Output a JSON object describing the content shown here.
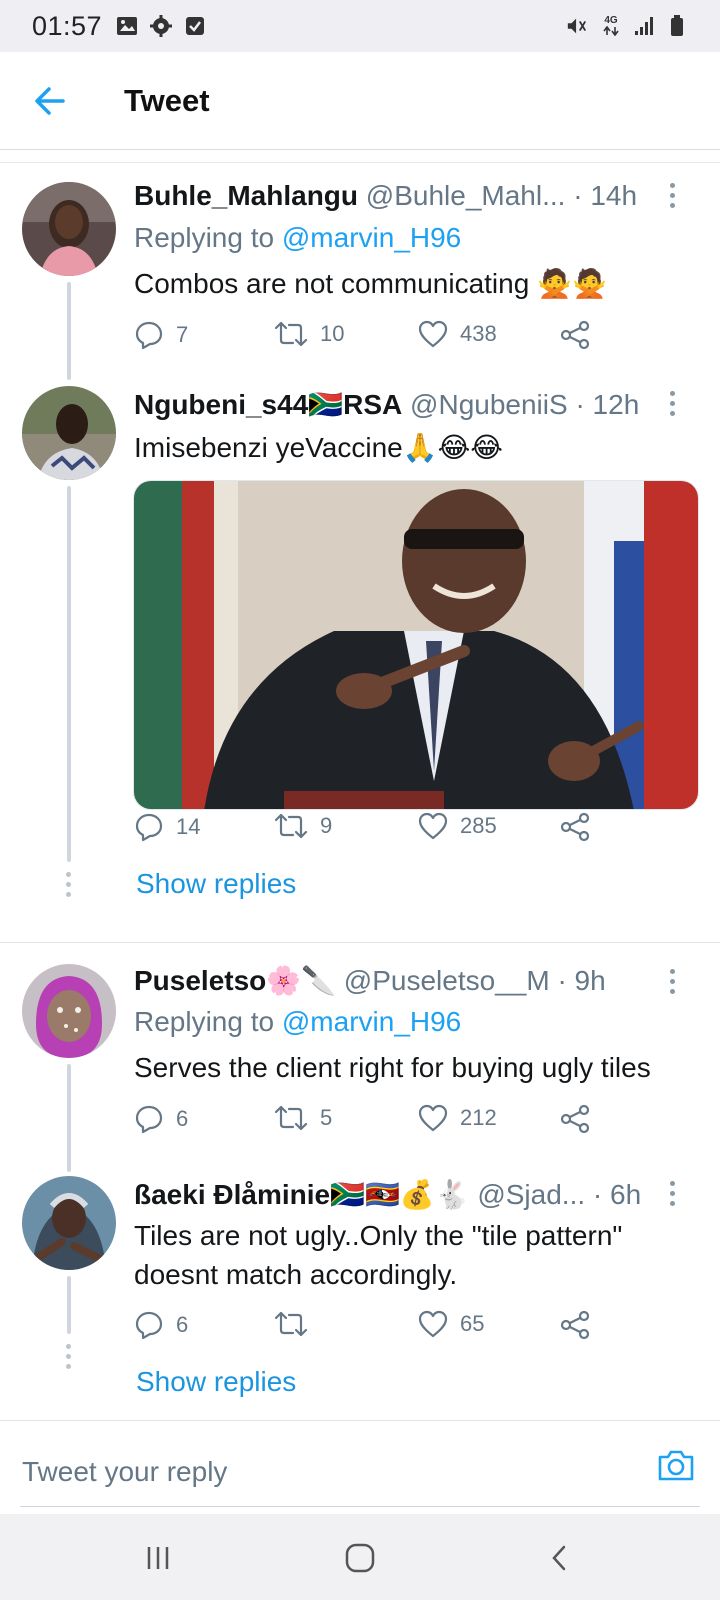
{
  "status_bar": {
    "time": "01:57",
    "left_icons": [
      "image-icon",
      "settings-icon",
      "checkbox-icon"
    ],
    "right_icons": [
      "mute-icon",
      "4g-icon",
      "signal-icon",
      "battery-icon"
    ],
    "network_label": "4G"
  },
  "header": {
    "title": "Tweet"
  },
  "tweets": [
    {
      "name": "Buhle_Mahlangu",
      "handle": "@Buhle_Mahl...",
      "time": "· 14h",
      "replying_prefix": "Replying to ",
      "replying_to": "@marvin_H96",
      "text": "Combos are not communicating 🙅🙅",
      "replies": "7",
      "retweets": "10",
      "likes": "438"
    },
    {
      "name": "Ngubeni_s44🇿🇦RSA",
      "handle": "@NgubeniiS",
      "time": "· 12h",
      "text": "Imisebenzi yeVaccine🙏😂😂",
      "replies": "14",
      "retweets": "9",
      "likes": "285",
      "show_replies": "Show replies"
    },
    {
      "name": "Puseletso🌸🔪",
      "handle": "@Puseletso__M",
      "time": "· 9h",
      "replying_prefix": "Replying to ",
      "replying_to": "@marvin_H96",
      "text": "Serves the client right for buying ugly tiles",
      "replies": "6",
      "retweets": "5",
      "likes": "212"
    },
    {
      "name": "ßaeki Ðlåminie🇿🇦🇸🇿💰🐇",
      "handle": "@Sjad...",
      "time": "· 6h",
      "text": "Tiles are not ugly..Only the \"tile pattern\" doesnt match accordingly.",
      "replies": "6",
      "retweets": "",
      "likes": "65",
      "show_replies": "Show replies"
    }
  ],
  "composer": {
    "placeholder": "Tweet your reply"
  },
  "colors": {
    "accent": "#1da1f2",
    "secondary_text": "#657786",
    "primary_text": "#14171a"
  }
}
